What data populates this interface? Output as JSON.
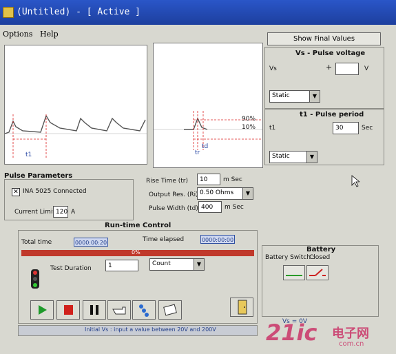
{
  "window": {
    "title": "(Untitled) - [ Active ]"
  },
  "menu": {
    "options": "Options",
    "help": "Help"
  },
  "plots": {
    "pulse_label": "t1",
    "level_90": "90%",
    "level_10": "10%",
    "rise_label": "tr",
    "width_label": "td"
  },
  "vs_panel": {
    "show_final_values": "Show Final Values",
    "title": "Vs - Pulse voltage",
    "label": "Vs",
    "sign": "+",
    "value": "",
    "unit": "V",
    "mode": "Static"
  },
  "t1_panel": {
    "title": "t1 - Pulse period",
    "label": "t1",
    "value": "30",
    "unit": "Sec",
    "mode": "Static"
  },
  "pulse_params": {
    "title": "Pulse Parameters",
    "checkbox_label": "INA 5025 Connected",
    "checkbox_checked": true,
    "current_limit_label": "Current Limit",
    "current_limit_value": "120",
    "current_limit_unit": "A",
    "rise_time_label": "Rise Time (tr)",
    "rise_time_value": "10",
    "rise_time_unit": "m Sec",
    "output_res_label": "Output Res. (Ri)",
    "output_res_value": "0.50 Ohms",
    "pulse_width_label": "Pulse Width (td)",
    "pulse_width_value": "400",
    "pulse_width_unit": "m Sec"
  },
  "runtime": {
    "title": "Run-time Control",
    "total_time_label": "Total time",
    "total_time_value": "0000:00:20",
    "elapsed_label": "Time elapsed",
    "elapsed_value": "0000:00:00",
    "progress_text": "0%",
    "progress": 0,
    "test_duration_label": "Test Duration",
    "test_duration_value": "1",
    "test_duration_unit": "Count"
  },
  "battery": {
    "title": "Battery",
    "switch_label": "Battery Switch :",
    "switch_state": "Closed"
  },
  "status": {
    "message": "Initial Vs : input a value between 20V and 200V",
    "right_text": "Vs = 0V"
  },
  "watermark": {
    "logo": "21ic",
    "cn": "电子网",
    "url": "com.cn"
  },
  "colors": {
    "title_bar": "#2350c0",
    "progress_bar": "#c0392b",
    "play": "#1e9a2a",
    "stop": "#d0211c",
    "watermark": "#c81e5a"
  }
}
